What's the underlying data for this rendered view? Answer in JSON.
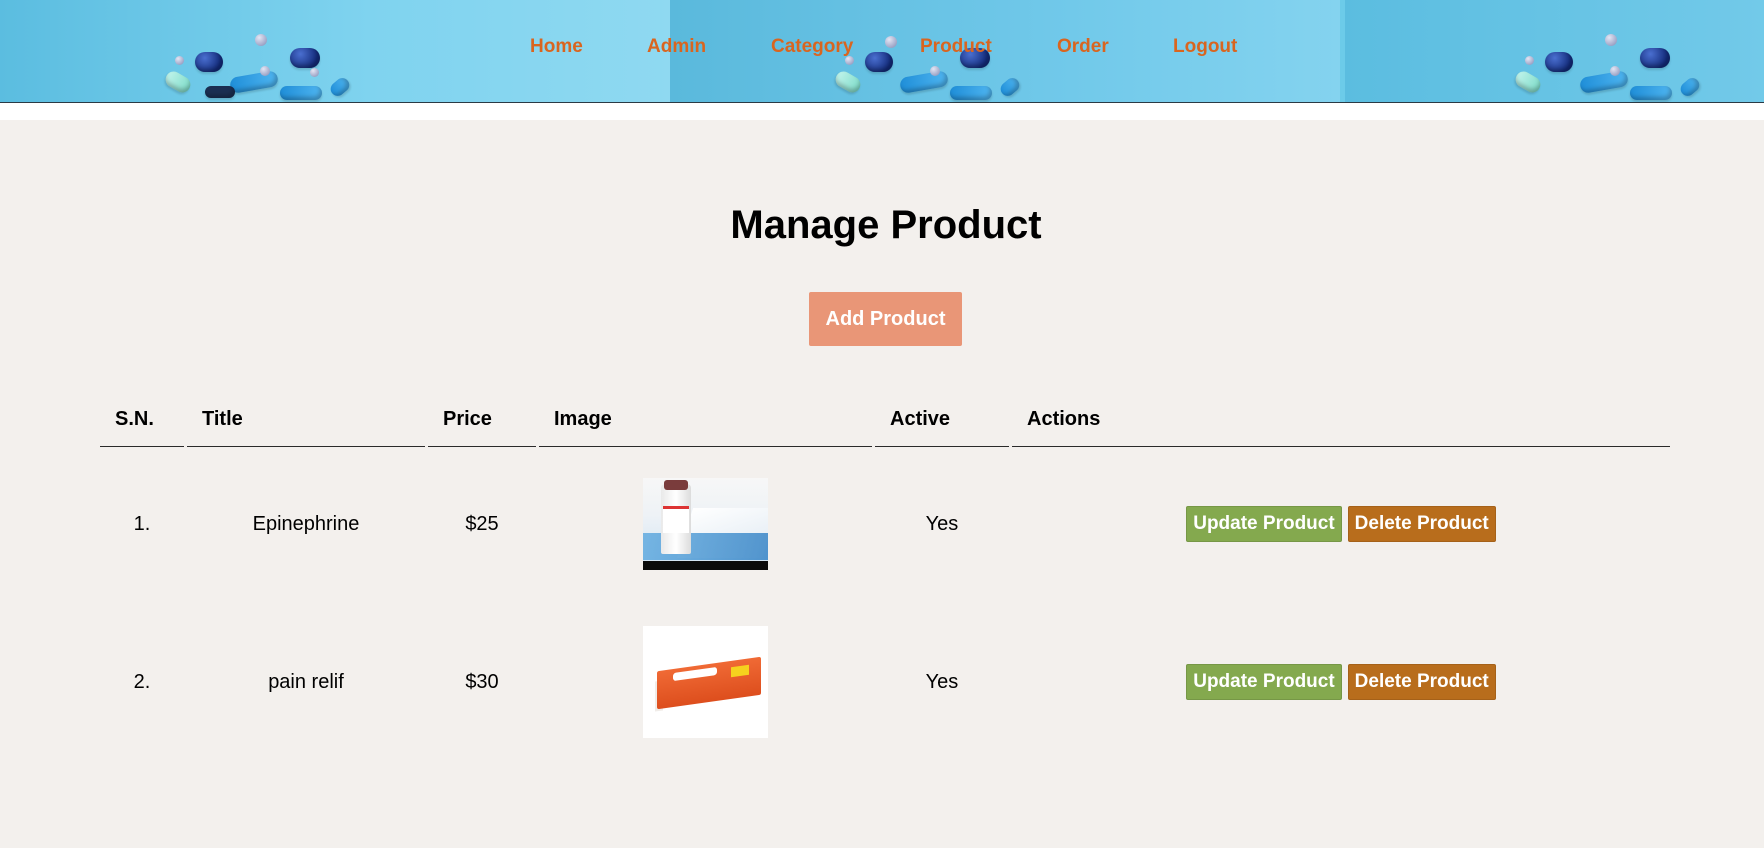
{
  "nav": {
    "items": [
      {
        "label": "Home"
      },
      {
        "label": "Admin"
      },
      {
        "label": "Category"
      },
      {
        "label": "Product"
      },
      {
        "label": "Order"
      },
      {
        "label": "Logout"
      }
    ]
  },
  "main": {
    "title": "Manage Product",
    "add_button": "Add Product"
  },
  "table": {
    "headers": [
      "S.N.",
      "Title",
      "Price",
      "Image",
      "Active",
      "Actions"
    ],
    "rows": [
      {
        "sn": "1.",
        "title": "Epinephrine",
        "price": "$25",
        "image": "epinephrine vial with face mask",
        "active": "Yes",
        "update_label": "Update Product",
        "delete_label": "Delete Product"
      },
      {
        "sn": "2.",
        "title": "pain relif",
        "price": "$30",
        "image": "orange painkiller box",
        "active": "Yes",
        "update_label": "Update Product",
        "delete_label": "Delete Product"
      }
    ]
  },
  "colors": {
    "nav_link": "#d9651f",
    "add_button": "#e99677",
    "update_button": "#84a94e",
    "delete_button": "#b86d1c",
    "page_background": "#f3f0ed",
    "banner": "#6ccbe9"
  }
}
